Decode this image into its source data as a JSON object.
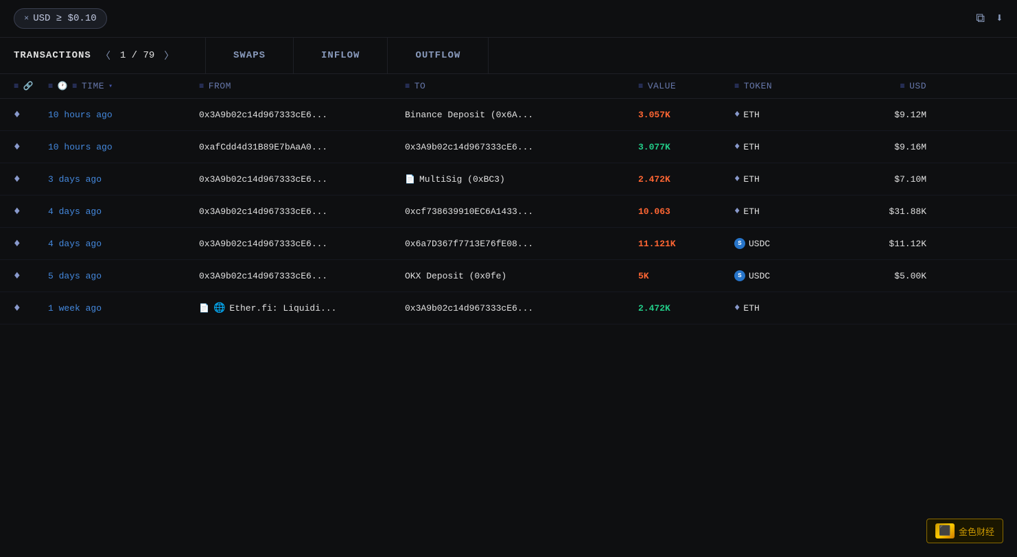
{
  "filter": {
    "label": "USD ≥ $0.10",
    "x": "×"
  },
  "tabs": {
    "transactions": "TRANSACTIONS",
    "page_current": "1",
    "page_separator": "/",
    "page_total": "79",
    "swaps": "SWAPS",
    "inflow": "INFLOW",
    "outflow": "OUTFLOW"
  },
  "columns": {
    "time": "TIME",
    "from": "FROM",
    "to": "TO",
    "value": "VALUE",
    "token": "TOKEN",
    "usd": "USD"
  },
  "rows": [
    {
      "chain_icon": "♦",
      "time": "10 hours ago",
      "from": "0x3A9b02c14d967333cE6...",
      "to": "Binance Deposit (0x6A...",
      "to_type": "address",
      "value": "3.057K",
      "value_color": "orange",
      "token": "ETH",
      "usd": "$9.12M"
    },
    {
      "chain_icon": "♦",
      "time": "10 hours ago",
      "from": "0xafCdd4d31B89E7bAaA0...",
      "to": "0x3A9b02c14d967333cE6...",
      "to_type": "address",
      "value": "3.077K",
      "value_color": "green",
      "token": "ETH",
      "usd": "$9.16M"
    },
    {
      "chain_icon": "♦",
      "time": "3 days ago",
      "from": "0x3A9b02c14d967333cE6...",
      "to": "MultiSig (0xBC3)",
      "to_type": "contract",
      "value": "2.472K",
      "value_color": "orange",
      "token": "ETH",
      "usd": "$7.10M"
    },
    {
      "chain_icon": "♦",
      "time": "4 days ago",
      "from": "0x3A9b02c14d967333cE6...",
      "to": "0xcf738639910EC6A1433...",
      "to_type": "address",
      "value": "10.063",
      "value_color": "orange",
      "token": "ETH",
      "usd": "$31.88K"
    },
    {
      "chain_icon": "♦",
      "time": "4 days ago",
      "from": "0x3A9b02c14d967333cE6...",
      "to": "0x6a7D367f7713E76fE08...",
      "to_type": "address",
      "value": "11.121K",
      "value_color": "orange",
      "token": "USDC",
      "usd": "$11.12K"
    },
    {
      "chain_icon": "♦",
      "time": "5 days ago",
      "from": "0x3A9b02c14d967333cE6...",
      "to": "OKX Deposit (0x0fe)",
      "to_type": "address",
      "value": "5K",
      "value_color": "orange",
      "token": "USDC",
      "usd": "$5.00K"
    },
    {
      "chain_icon": "♦",
      "time": "1 week ago",
      "from": "Ether.fi: Liquidi...",
      "from_type": "contract_globe",
      "to": "0x3A9b02c14d967333cE6...",
      "to_type": "address",
      "value": "2.472K",
      "value_color": "green",
      "token": "ETH",
      "usd": ""
    }
  ],
  "watermark": {
    "text": "金色财经",
    "icon": "₿"
  }
}
